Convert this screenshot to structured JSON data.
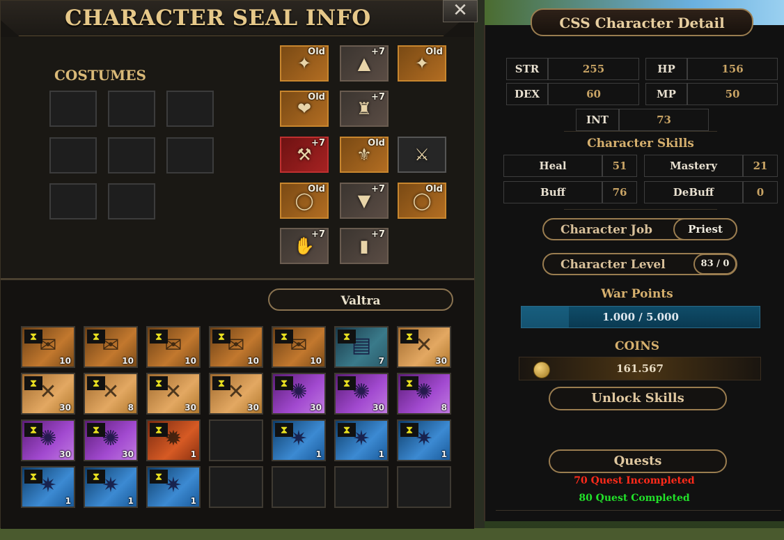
{
  "left_panel": {
    "title": "CHARACTER SEAL INFO",
    "close_glyph": "✕",
    "costumes_label": "COSTUMES",
    "equipment": [
      {
        "slot": "earring-left",
        "tag": "Old",
        "style": "old",
        "icon": "✦"
      },
      {
        "slot": "cape",
        "tag": "+7",
        "style": "plus",
        "icon": "▲"
      },
      {
        "slot": "earring-right",
        "tag": "Old",
        "style": "old",
        "icon": "✦"
      },
      {
        "slot": "necklace",
        "tag": "Old",
        "style": "old",
        "icon": "❤"
      },
      {
        "slot": "chest-armor",
        "tag": "+7",
        "style": "plus",
        "icon": "♜"
      },
      {
        "slot": "weapon",
        "tag": "+7",
        "style": "red",
        "icon": "⚒"
      },
      {
        "slot": "belt",
        "tag": "Old",
        "style": "old",
        "icon": "⚜"
      },
      {
        "slot": "shield",
        "tag": "",
        "style": "grey",
        "icon": "⚔"
      },
      {
        "slot": "ring-left",
        "tag": "Old",
        "style": "old",
        "icon": "◯"
      },
      {
        "slot": "pants",
        "tag": "+7",
        "style": "plus",
        "icon": "▼"
      },
      {
        "slot": "ring-right",
        "tag": "Old",
        "style": "old",
        "icon": "◯"
      },
      {
        "slot": "gloves",
        "tag": "+7",
        "style": "plus",
        "icon": "✋"
      },
      {
        "slot": "boots",
        "tag": "+7",
        "style": "plus",
        "icon": "▮"
      }
    ],
    "inventory_name": "Valtra",
    "inventory": [
      {
        "type": "scroll",
        "qty": "10",
        "icon": "✉"
      },
      {
        "type": "scroll",
        "qty": "10",
        "icon": "✉"
      },
      {
        "type": "scroll",
        "qty": "10",
        "icon": "✉"
      },
      {
        "type": "scroll",
        "qty": "10",
        "icon": "✉"
      },
      {
        "type": "scroll",
        "qty": "10",
        "icon": "✉"
      },
      {
        "type": "book",
        "qty": "7",
        "icon": "▤"
      },
      {
        "type": "map",
        "qty": "30",
        "icon": "✕"
      },
      {
        "type": "map",
        "qty": "30",
        "icon": "✕"
      },
      {
        "type": "map",
        "qty": "8",
        "icon": "✕"
      },
      {
        "type": "map",
        "qty": "30",
        "icon": "✕"
      },
      {
        "type": "map",
        "qty": "30",
        "icon": "✕"
      },
      {
        "type": "purple",
        "qty": "30",
        "icon": "✺"
      },
      {
        "type": "purple",
        "qty": "30",
        "icon": "✺"
      },
      {
        "type": "purple",
        "qty": "8",
        "icon": "✺"
      },
      {
        "type": "purple",
        "qty": "30",
        "icon": "✺"
      },
      {
        "type": "purple",
        "qty": "30",
        "icon": "✺"
      },
      {
        "type": "star",
        "qty": "1",
        "icon": "✹"
      },
      {
        "type": "empty",
        "qty": "",
        "icon": ""
      },
      {
        "type": "blue",
        "qty": "1",
        "icon": "✷"
      },
      {
        "type": "blue",
        "qty": "1",
        "icon": "✷"
      },
      {
        "type": "blue",
        "qty": "1",
        "icon": "✷"
      },
      {
        "type": "blue",
        "qty": "1",
        "icon": "✷"
      },
      {
        "type": "blue",
        "qty": "1",
        "icon": "✷"
      },
      {
        "type": "blue",
        "qty": "1",
        "icon": "✷"
      },
      {
        "type": "empty",
        "qty": "",
        "icon": ""
      },
      {
        "type": "empty",
        "qty": "",
        "icon": ""
      },
      {
        "type": "empty",
        "qty": "",
        "icon": ""
      },
      {
        "type": "empty",
        "qty": "",
        "icon": ""
      }
    ]
  },
  "right_panel": {
    "title": "CSS Character Detail",
    "stats": {
      "str_label": "STR",
      "str_value": "255",
      "hp_label": "HP",
      "hp_value": "156",
      "dex_label": "DEX",
      "dex_value": "60",
      "mp_label": "MP",
      "mp_value": "50",
      "int_label": "INT",
      "int_value": "73"
    },
    "skills_heading": "Character Skills",
    "skills": {
      "heal_label": "Heal",
      "heal_value": "51",
      "mastery_label": "Mastery",
      "mastery_value": "21",
      "buff_label": "Buff",
      "buff_value": "76",
      "debuff_label": "DeBuff",
      "debuff_value": "0"
    },
    "job_label": "Character Job",
    "job_value": "Priest",
    "level_label": "Character Level",
    "level_value": "83 / 0",
    "war_points_heading": "War Points",
    "war_points_text": "1.000 / 5.000",
    "war_points_fraction": 0.2,
    "coins_heading": "COINS",
    "coins_value": "161.567",
    "unlock_label": "Unlock Skills",
    "quests_label": "Quests",
    "quest_incomplete": "70 Quest Incompleted",
    "quest_complete": "80 Quest Completed"
  },
  "colors": {
    "quest_incomplete": "#ff2a1a",
    "quest_complete": "#22e12a",
    "accent_gold": "#d6b06e"
  }
}
